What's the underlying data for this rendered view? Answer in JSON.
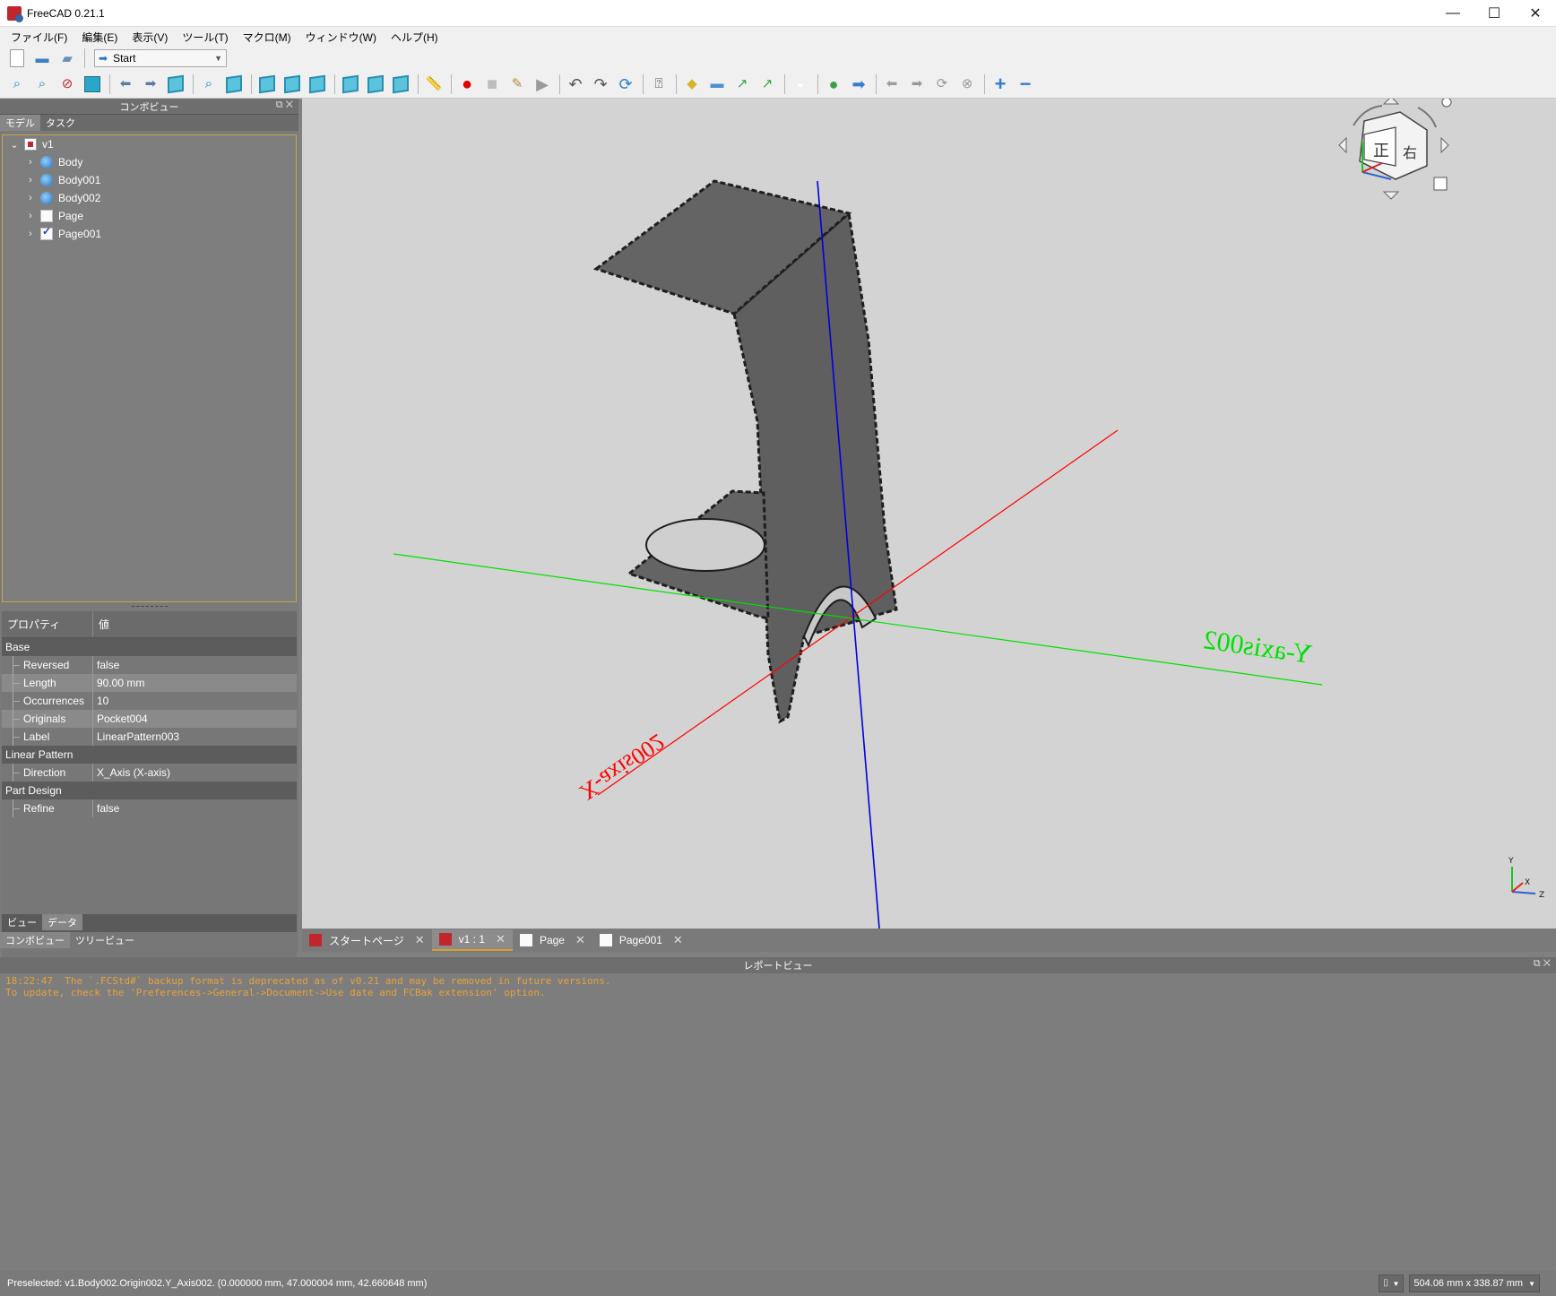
{
  "window": {
    "title": "FreeCAD 0.21.1",
    "controls": [
      "—",
      "☐",
      "✕"
    ]
  },
  "menu": [
    "ファイル(F)",
    "編集(E)",
    "表示(V)",
    "ツール(T)",
    "マクロ(M)",
    "ウィンドウ(W)",
    "ヘルプ(H)"
  ],
  "workbench": {
    "selected": "Start"
  },
  "combo": {
    "title": "コンボビュー",
    "tabs": [
      "モデル",
      "タスク"
    ],
    "tree": [
      {
        "label": "v1",
        "icon": "document-icon",
        "expanded": true,
        "level": 0
      },
      {
        "label": "Body",
        "icon": "body-icon",
        "level": 1
      },
      {
        "label": "Body001",
        "icon": "body-icon",
        "level": 1
      },
      {
        "label": "Body002",
        "icon": "body-icon",
        "level": 1
      },
      {
        "label": "Page",
        "icon": "page-icon",
        "level": 1
      },
      {
        "label": "Page001",
        "icon": "page-check-icon",
        "level": 1
      }
    ]
  },
  "properties": {
    "col_property": "プロパティ",
    "col_value": "値",
    "groups": [
      {
        "name": "Base",
        "rows": [
          {
            "key": "Reversed",
            "value": "false"
          },
          {
            "key": "Length",
            "value": "90.00 mm"
          },
          {
            "key": "Occurrences",
            "value": "10"
          },
          {
            "key": "Originals",
            "value": "Pocket004"
          },
          {
            "key": "Label",
            "value": "LinearPattern003"
          }
        ]
      },
      {
        "name": "Linear Pattern",
        "rows": [
          {
            "key": "Direction",
            "value": "X_Axis (X-axis)"
          }
        ]
      },
      {
        "name": "Part Design",
        "rows": [
          {
            "key": "Refine",
            "value": "false"
          }
        ]
      }
    ],
    "tabs": [
      "ビュー",
      "データ"
    ]
  },
  "bottom_tabs": [
    "コンボビュー",
    "ツリービュー"
  ],
  "view3d": {
    "background": "#d3d3d3",
    "x_axis_label": "X-axis002",
    "y_axis_label": "Y-axis002",
    "x_color": "#ff0000",
    "y_color": "#00e000",
    "z_color": "#0000dd",
    "mini_axis": {
      "x": "X",
      "y": "Y",
      "z": "Z"
    }
  },
  "doc_tabs": [
    {
      "label": "スタートページ",
      "icon": "freecad-icon",
      "active": false
    },
    {
      "label": "v1 : 1",
      "icon": "freecad-icon",
      "active": true
    },
    {
      "label": "Page",
      "icon": "page-icon",
      "active": false
    },
    {
      "label": "Page001",
      "icon": "page-icon",
      "active": false
    }
  ],
  "report": {
    "title": "レポートビュー",
    "lines": [
      "18:22:47  The `.FCStd#` backup format is deprecated as of v0.21 and may be removed in future versions.",
      "To update, check the 'Preferences->General->Document->Use date and FCBak extension' option."
    ]
  },
  "status": {
    "message": "Preselected: v1.Body002.Origin002.Y_Axis002. (0.000000 mm, 47.000004 mm, 42.660648 mm)",
    "dimensions": "504.06 mm x 338.87 mm"
  }
}
